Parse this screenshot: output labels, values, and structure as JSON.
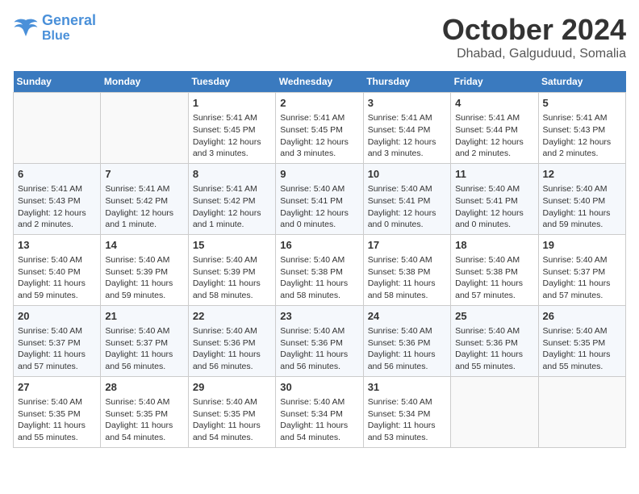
{
  "header": {
    "logo_line1": "General",
    "logo_line2": "Blue",
    "month": "October 2024",
    "location": "Dhabad, Galguduud, Somalia"
  },
  "days_of_week": [
    "Sunday",
    "Monday",
    "Tuesday",
    "Wednesday",
    "Thursday",
    "Friday",
    "Saturday"
  ],
  "weeks": [
    [
      {
        "day": "",
        "info": ""
      },
      {
        "day": "",
        "info": ""
      },
      {
        "day": "1",
        "info": "Sunrise: 5:41 AM\nSunset: 5:45 PM\nDaylight: 12 hours and 3 minutes."
      },
      {
        "day": "2",
        "info": "Sunrise: 5:41 AM\nSunset: 5:45 PM\nDaylight: 12 hours and 3 minutes."
      },
      {
        "day": "3",
        "info": "Sunrise: 5:41 AM\nSunset: 5:44 PM\nDaylight: 12 hours and 3 minutes."
      },
      {
        "day": "4",
        "info": "Sunrise: 5:41 AM\nSunset: 5:44 PM\nDaylight: 12 hours and 2 minutes."
      },
      {
        "day": "5",
        "info": "Sunrise: 5:41 AM\nSunset: 5:43 PM\nDaylight: 12 hours and 2 minutes."
      }
    ],
    [
      {
        "day": "6",
        "info": "Sunrise: 5:41 AM\nSunset: 5:43 PM\nDaylight: 12 hours and 2 minutes."
      },
      {
        "day": "7",
        "info": "Sunrise: 5:41 AM\nSunset: 5:42 PM\nDaylight: 12 hours and 1 minute."
      },
      {
        "day": "8",
        "info": "Sunrise: 5:41 AM\nSunset: 5:42 PM\nDaylight: 12 hours and 1 minute."
      },
      {
        "day": "9",
        "info": "Sunrise: 5:40 AM\nSunset: 5:41 PM\nDaylight: 12 hours and 0 minutes."
      },
      {
        "day": "10",
        "info": "Sunrise: 5:40 AM\nSunset: 5:41 PM\nDaylight: 12 hours and 0 minutes."
      },
      {
        "day": "11",
        "info": "Sunrise: 5:40 AM\nSunset: 5:41 PM\nDaylight: 12 hours and 0 minutes."
      },
      {
        "day": "12",
        "info": "Sunrise: 5:40 AM\nSunset: 5:40 PM\nDaylight: 11 hours and 59 minutes."
      }
    ],
    [
      {
        "day": "13",
        "info": "Sunrise: 5:40 AM\nSunset: 5:40 PM\nDaylight: 11 hours and 59 minutes."
      },
      {
        "day": "14",
        "info": "Sunrise: 5:40 AM\nSunset: 5:39 PM\nDaylight: 11 hours and 59 minutes."
      },
      {
        "day": "15",
        "info": "Sunrise: 5:40 AM\nSunset: 5:39 PM\nDaylight: 11 hours and 58 minutes."
      },
      {
        "day": "16",
        "info": "Sunrise: 5:40 AM\nSunset: 5:38 PM\nDaylight: 11 hours and 58 minutes."
      },
      {
        "day": "17",
        "info": "Sunrise: 5:40 AM\nSunset: 5:38 PM\nDaylight: 11 hours and 58 minutes."
      },
      {
        "day": "18",
        "info": "Sunrise: 5:40 AM\nSunset: 5:38 PM\nDaylight: 11 hours and 57 minutes."
      },
      {
        "day": "19",
        "info": "Sunrise: 5:40 AM\nSunset: 5:37 PM\nDaylight: 11 hours and 57 minutes."
      }
    ],
    [
      {
        "day": "20",
        "info": "Sunrise: 5:40 AM\nSunset: 5:37 PM\nDaylight: 11 hours and 57 minutes."
      },
      {
        "day": "21",
        "info": "Sunrise: 5:40 AM\nSunset: 5:37 PM\nDaylight: 11 hours and 56 minutes."
      },
      {
        "day": "22",
        "info": "Sunrise: 5:40 AM\nSunset: 5:36 PM\nDaylight: 11 hours and 56 minutes."
      },
      {
        "day": "23",
        "info": "Sunrise: 5:40 AM\nSunset: 5:36 PM\nDaylight: 11 hours and 56 minutes."
      },
      {
        "day": "24",
        "info": "Sunrise: 5:40 AM\nSunset: 5:36 PM\nDaylight: 11 hours and 56 minutes."
      },
      {
        "day": "25",
        "info": "Sunrise: 5:40 AM\nSunset: 5:36 PM\nDaylight: 11 hours and 55 minutes."
      },
      {
        "day": "26",
        "info": "Sunrise: 5:40 AM\nSunset: 5:35 PM\nDaylight: 11 hours and 55 minutes."
      }
    ],
    [
      {
        "day": "27",
        "info": "Sunrise: 5:40 AM\nSunset: 5:35 PM\nDaylight: 11 hours and 55 minutes."
      },
      {
        "day": "28",
        "info": "Sunrise: 5:40 AM\nSunset: 5:35 PM\nDaylight: 11 hours and 54 minutes."
      },
      {
        "day": "29",
        "info": "Sunrise: 5:40 AM\nSunset: 5:35 PM\nDaylight: 11 hours and 54 minutes."
      },
      {
        "day": "30",
        "info": "Sunrise: 5:40 AM\nSunset: 5:34 PM\nDaylight: 11 hours and 54 minutes."
      },
      {
        "day": "31",
        "info": "Sunrise: 5:40 AM\nSunset: 5:34 PM\nDaylight: 11 hours and 53 minutes."
      },
      {
        "day": "",
        "info": ""
      },
      {
        "day": "",
        "info": ""
      }
    ]
  ]
}
